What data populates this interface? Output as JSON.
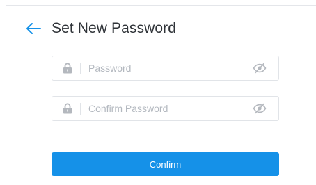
{
  "header": {
    "title": "Set New Password",
    "back_icon": "arrow-left-icon"
  },
  "form": {
    "password": {
      "placeholder": "Password",
      "value": "",
      "lock_icon": "lock-icon",
      "visibility_icon": "eye-slash-icon"
    },
    "confirm_password": {
      "placeholder": "Confirm Password",
      "value": "",
      "lock_icon": "lock-icon",
      "visibility_icon": "eye-slash-icon"
    },
    "submit_label": "Confirm"
  },
  "colors": {
    "accent": "#1591e8",
    "title_text": "#2f3338",
    "placeholder_text": "#b3b8bf",
    "border": "#e1e4e8",
    "icon": "#b4b8be"
  }
}
